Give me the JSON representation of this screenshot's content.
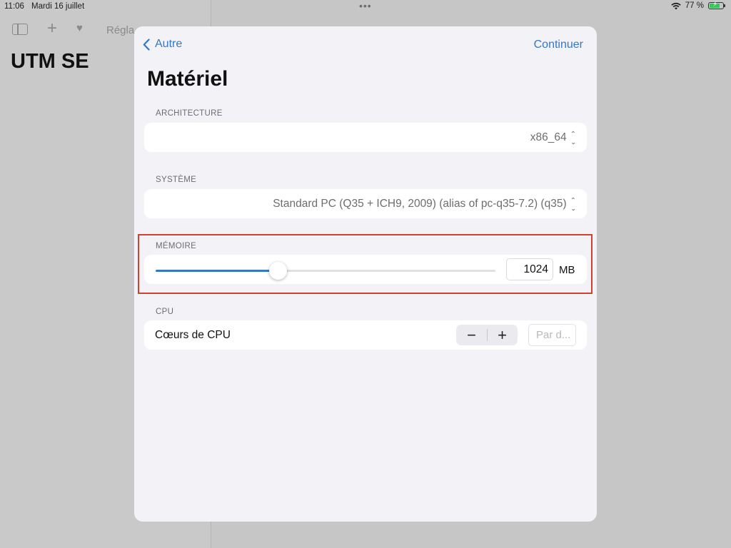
{
  "status_bar": {
    "time": "11:06",
    "date": "Mardi 16 juillet",
    "battery_percent": "77 %",
    "battery_level": 0.77
  },
  "background_app": {
    "toolbar_label": "Régla",
    "title": "UTM SE"
  },
  "sheet": {
    "back_label": "Autre",
    "continue_label": "Continuer",
    "title": "Matériel",
    "architecture": {
      "label": "ARCHITECTURE",
      "value": "x86_64"
    },
    "system": {
      "label": "SYSTÈME",
      "value": "Standard PC (Q35 + ICH9, 2009) (alias of pc-q35-7.2) (q35)"
    },
    "memory": {
      "label": "MÉMOIRE",
      "value": "1024",
      "unit": "MB",
      "slider_fraction": 0.36
    },
    "cpu": {
      "label": "CPU",
      "cores_label": "Cœurs de CPU",
      "minus": "−",
      "plus": "+",
      "placeholder": "Par d..."
    }
  },
  "colors": {
    "accent": "#3478c6",
    "highlight": "#d5402e"
  }
}
